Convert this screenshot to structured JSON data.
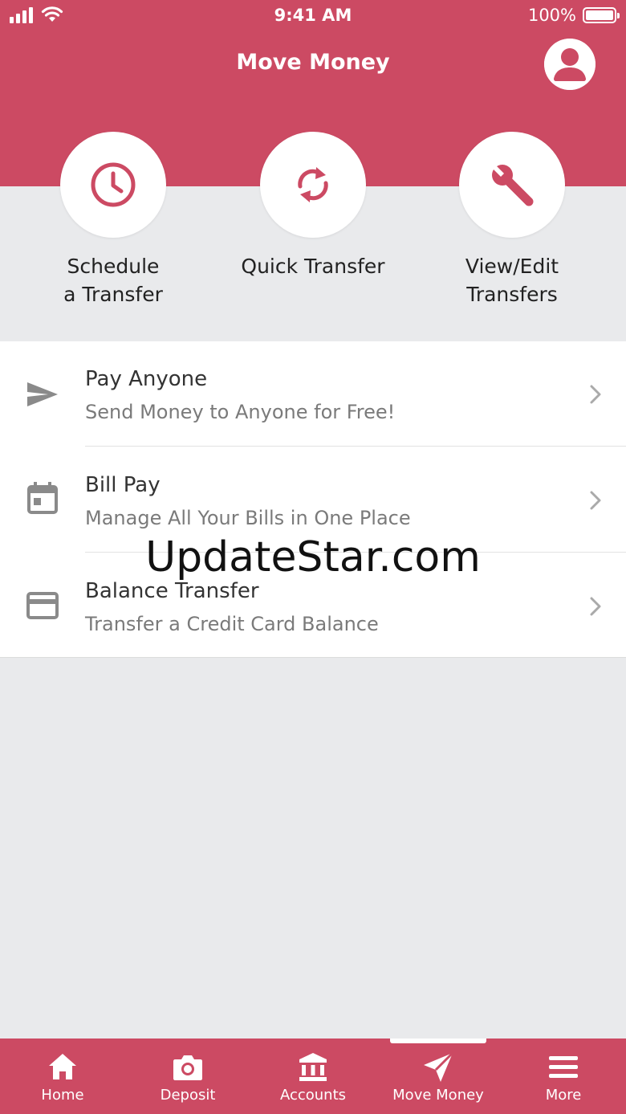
{
  "status_bar": {
    "time": "9:41 AM",
    "battery": "100%"
  },
  "header": {
    "title": "Move Money"
  },
  "quick_actions": [
    {
      "line1": "Schedule",
      "line2": "a Transfer",
      "icon": "clock-icon"
    },
    {
      "line1": "Quick Transfer",
      "line2": "",
      "icon": "sync-icon"
    },
    {
      "line1": "View/Edit",
      "line2": "Transfers",
      "icon": "wrench-icon"
    }
  ],
  "list": [
    {
      "title": "Pay Anyone",
      "subtitle": "Send Money to Anyone for Free!",
      "icon": "send-icon"
    },
    {
      "title": "Bill Pay",
      "subtitle": "Manage All Your Bills in One Place",
      "icon": "calendar-icon"
    },
    {
      "title": "Balance Transfer",
      "subtitle": "Transfer a Credit Card Balance",
      "icon": "credit-card-icon"
    }
  ],
  "watermark": "UpdateStar.com",
  "tabs": [
    {
      "label": "Home",
      "icon": "home-icon"
    },
    {
      "label": "Deposit",
      "icon": "camera-icon"
    },
    {
      "label": "Accounts",
      "icon": "bank-icon"
    },
    {
      "label": "Move Money",
      "icon": "paper-plane-icon",
      "active": true
    },
    {
      "label": "More",
      "icon": "menu-icon"
    }
  ],
  "colors": {
    "brand": "#cc4a63",
    "background": "#e9eaec",
    "icon_gray": "#8a8a8a"
  }
}
